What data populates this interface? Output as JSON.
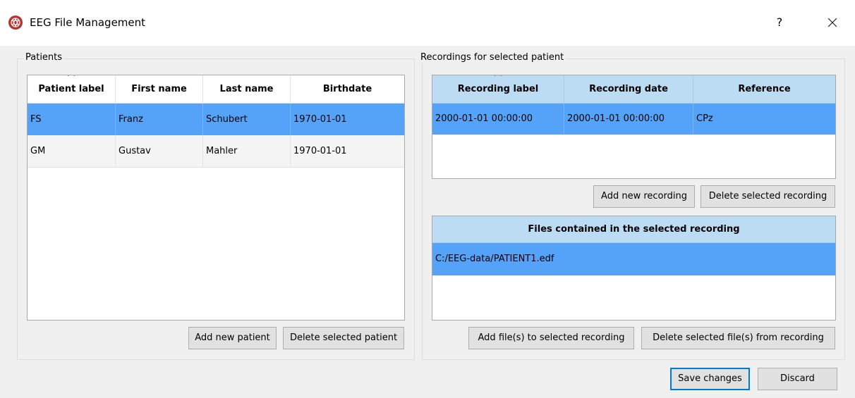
{
  "window": {
    "title": "EEG File Management",
    "help_label": "?",
    "icon": "eeg-app-icon"
  },
  "patients": {
    "group_title": "Patients",
    "columns": [
      "Patient label",
      "First name",
      "Last name",
      "Birthdate"
    ],
    "rows": [
      [
        "FS",
        "Franz",
        "Schubert",
        "1970-01-01"
      ],
      [
        "GM",
        "Gustav",
        "Mahler",
        "1970-01-01"
      ]
    ],
    "selected_row": 0,
    "sorted_column": 0,
    "add_button": "Add new patient",
    "delete_button": "Delete selected patient"
  },
  "recordings": {
    "group_title": "Recordings for selected patient",
    "columns": [
      "Recording label",
      "Recording date",
      "Reference"
    ],
    "rows": [
      [
        "2000-01-01 00:00:00",
        "2000-01-01 00:00:00",
        "CPz"
      ]
    ],
    "selected_row": 0,
    "sorted_column": 0,
    "add_button": "Add new recording",
    "delete_button": "Delete selected recording"
  },
  "files": {
    "column": "Files contained in the selected recording",
    "rows": [
      "C:/EEG-data/PATIENT1.edf"
    ],
    "selected_row": 0,
    "add_button": "Add file(s) to selected recording",
    "delete_button": "Delete selected file(s) from recording"
  },
  "footer": {
    "save_button": "Save changes",
    "discard_button": "Discard"
  },
  "colors": {
    "selection": "#55a3f8",
    "header_blue": "#bcdcf4",
    "default_button_border": "#0078d7"
  }
}
